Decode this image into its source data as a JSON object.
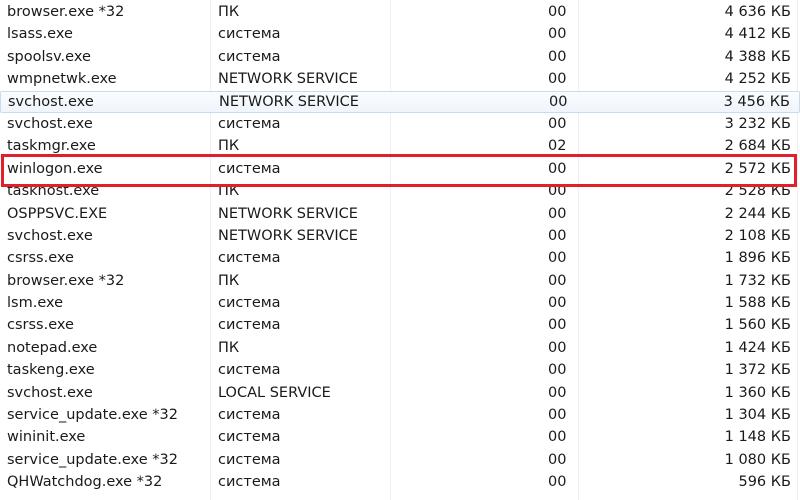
{
  "processes": [
    {
      "name": "browser.exe *32",
      "user": "ПК",
      "cpu": "00",
      "memory": "4 636 КБ"
    },
    {
      "name": "lsass.exe",
      "user": "система",
      "cpu": "00",
      "memory": "4 412 КБ"
    },
    {
      "name": "spoolsv.exe",
      "user": "система",
      "cpu": "00",
      "memory": "4 388 КБ"
    },
    {
      "name": "wmpnetwk.exe",
      "user": "NETWORK SERVICE",
      "cpu": "00",
      "memory": "4 252 КБ"
    },
    {
      "name": "svchost.exe",
      "user": "NETWORK SERVICE",
      "cpu": "00",
      "memory": "3 456 КБ",
      "hover": true
    },
    {
      "name": "svchost.exe",
      "user": "система",
      "cpu": "00",
      "memory": "3 232 КБ"
    },
    {
      "name": "taskmgr.exe",
      "user": "ПК",
      "cpu": "02",
      "memory": "2 684 КБ"
    },
    {
      "name": "winlogon.exe",
      "user": "система",
      "cpu": "00",
      "memory": "2 572 КБ",
      "highlighted": true
    },
    {
      "name": "taskhost.exe",
      "user": "ПК",
      "cpu": "00",
      "memory": "2 528 КБ"
    },
    {
      "name": "OSPPSVC.EXE",
      "user": "NETWORK SERVICE",
      "cpu": "00",
      "memory": "2 244 КБ"
    },
    {
      "name": "svchost.exe",
      "user": "NETWORK SERVICE",
      "cpu": "00",
      "memory": "2 108 КБ"
    },
    {
      "name": "csrss.exe",
      "user": "система",
      "cpu": "00",
      "memory": "1 896 КБ"
    },
    {
      "name": "browser.exe *32",
      "user": "ПК",
      "cpu": "00",
      "memory": "1 732 КБ"
    },
    {
      "name": "lsm.exe",
      "user": "система",
      "cpu": "00",
      "memory": "1 588 КБ"
    },
    {
      "name": "csrss.exe",
      "user": "система",
      "cpu": "00",
      "memory": "1 560 КБ"
    },
    {
      "name": "notepad.exe",
      "user": "ПК",
      "cpu": "00",
      "memory": "1 424 КБ"
    },
    {
      "name": "taskeng.exe",
      "user": "система",
      "cpu": "00",
      "memory": "1 372 КБ"
    },
    {
      "name": "svchost.exe",
      "user": "LOCAL SERVICE",
      "cpu": "00",
      "memory": "1 360 КБ"
    },
    {
      "name": "service_update.exe *32",
      "user": "система",
      "cpu": "00",
      "memory": "1 304 КБ"
    },
    {
      "name": "wininit.exe",
      "user": "система",
      "cpu": "00",
      "memory": "1 148 КБ"
    },
    {
      "name": "service_update.exe *32",
      "user": "система",
      "cpu": "00",
      "memory": "1 080 КБ"
    },
    {
      "name": "QHWatchdog.exe *32",
      "user": "система",
      "cpu": "00",
      "memory": "596 КБ"
    }
  ],
  "colors": {
    "highlight_box": "#e0202a",
    "hover_border": "#c9dcef"
  }
}
